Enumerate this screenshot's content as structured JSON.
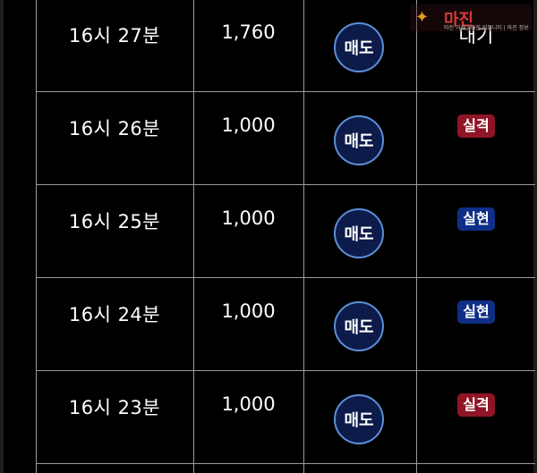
{
  "rows": [
    {
      "time": "16시 27분",
      "amount": "1,760",
      "trade_label": "매도",
      "status": "대기",
      "status_kind": "text"
    },
    {
      "time": "16시 26분",
      "amount": "1,000",
      "trade_label": "매도",
      "status": "실격",
      "status_kind": "fail"
    },
    {
      "time": "16시 25분",
      "amount": "1,000",
      "trade_label": "매도",
      "status": "실현",
      "status_kind": "success"
    },
    {
      "time": "16시 24분",
      "amount": "1,000",
      "trade_label": "매도",
      "status": "실현",
      "status_kind": "success"
    },
    {
      "time": "16시 23분",
      "amount": "1,000",
      "trade_label": "매도",
      "status": "실격",
      "status_kind": "fail"
    }
  ],
  "watermark": {
    "text": "마진",
    "emblem": "eagle-icon",
    "subtext": "마진 거래 | 마진 커뮤니티 | 마진 정보"
  },
  "colors": {
    "background": "#000000",
    "fail": "#8f1526",
    "success": "#0f2f86",
    "button": "#0d1b4a",
    "button_border": "#5b8fd9",
    "grid": "#9a9a9a"
  }
}
